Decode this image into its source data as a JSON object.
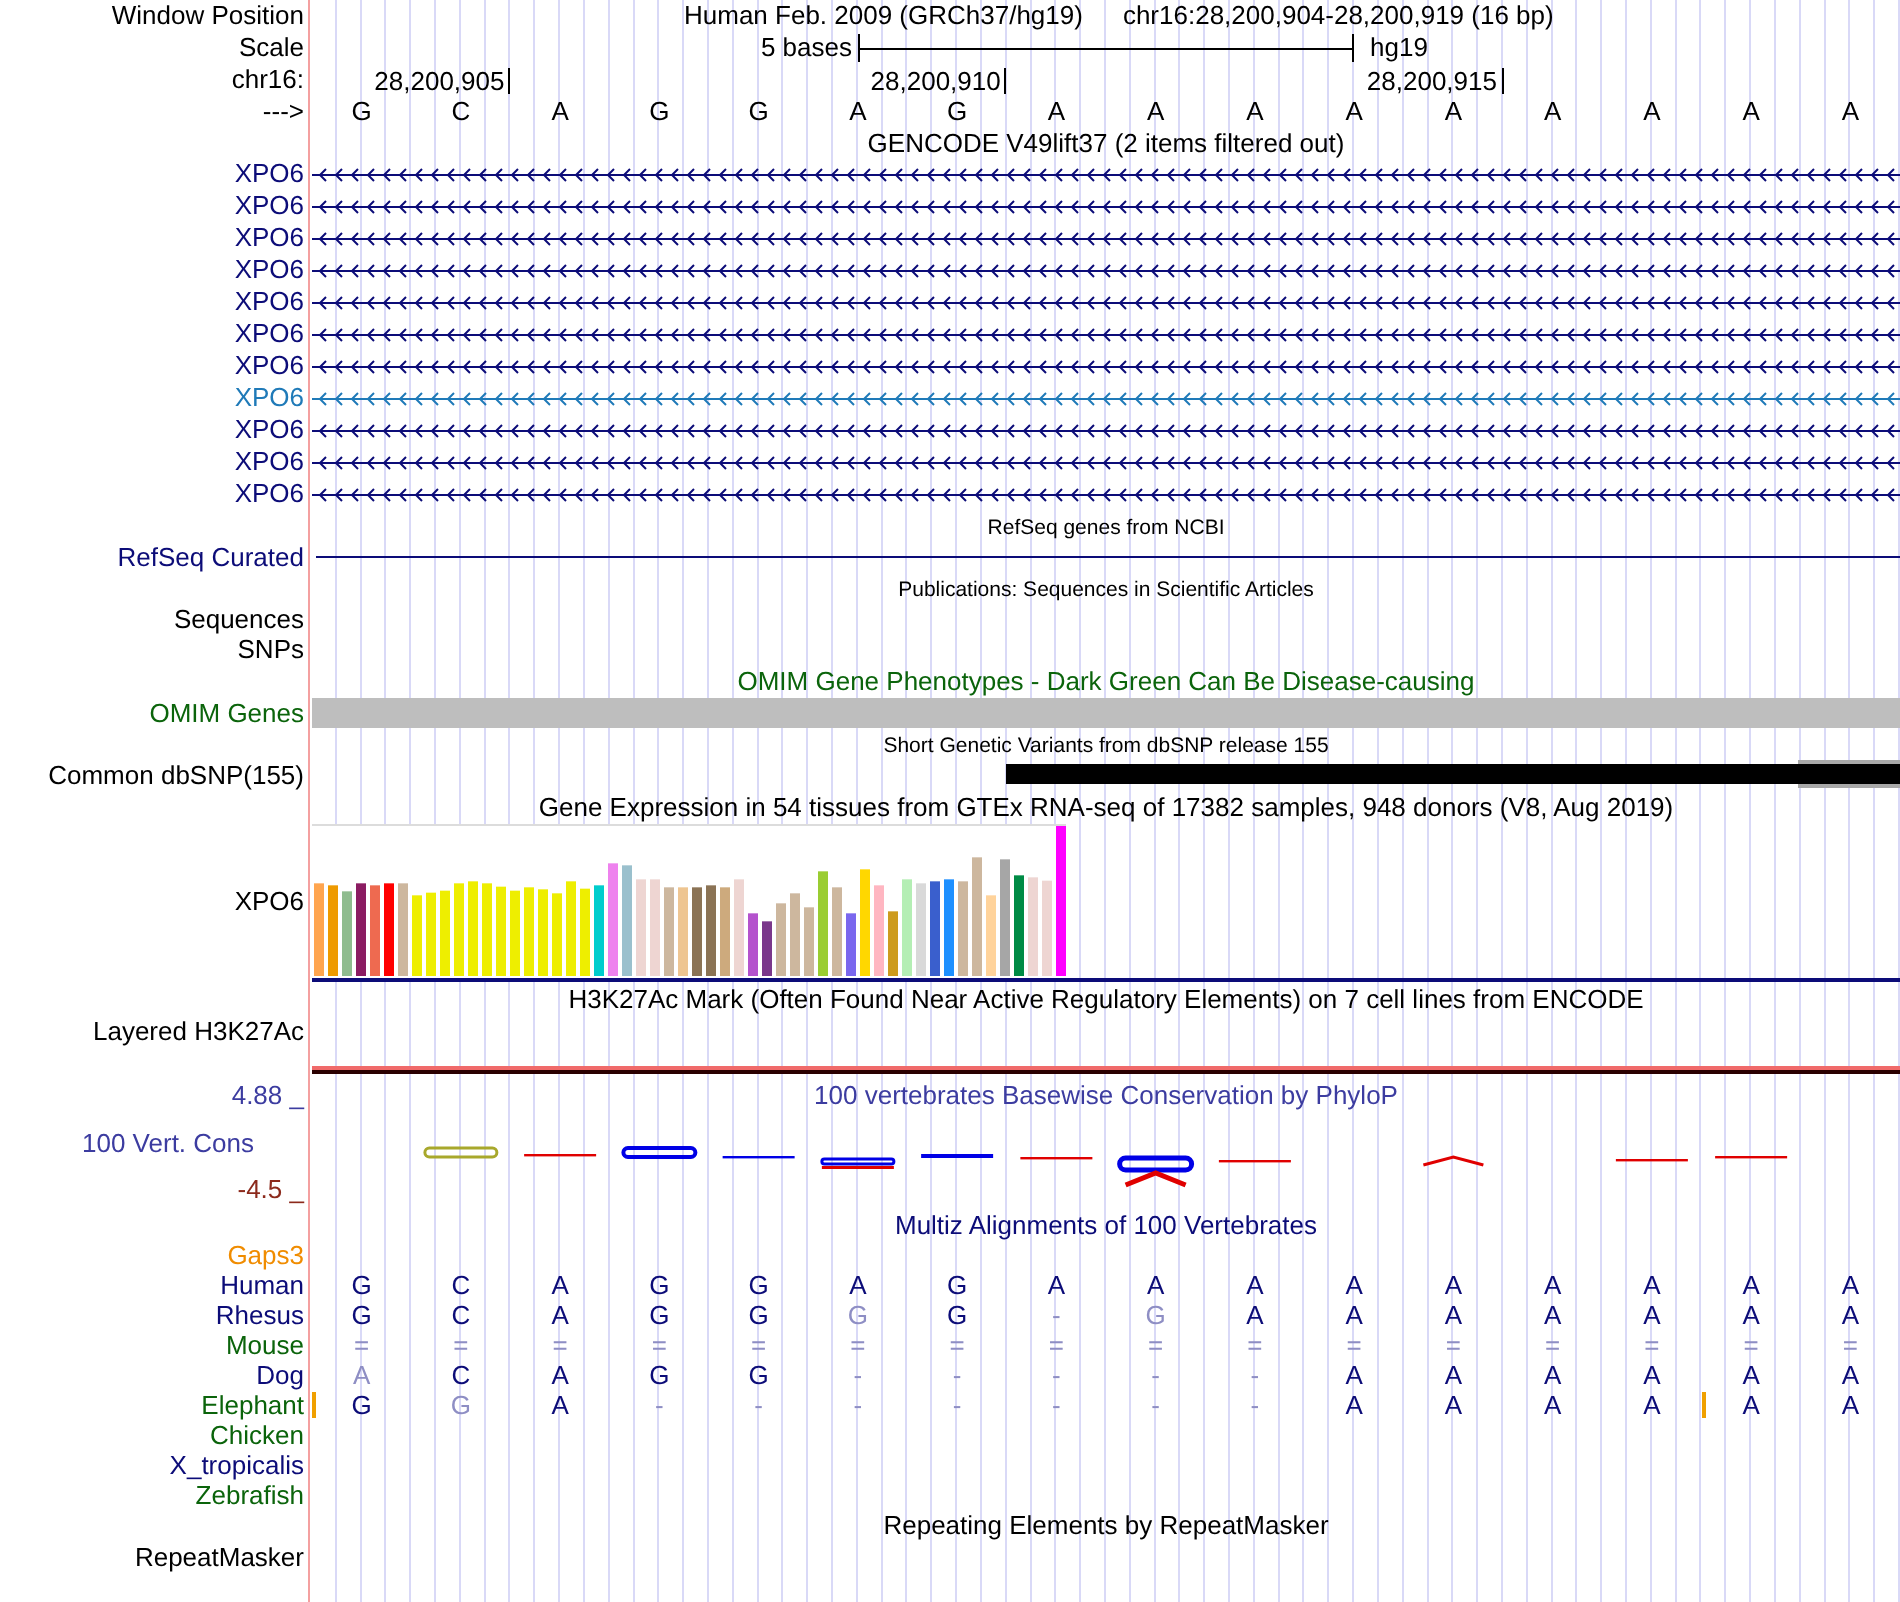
{
  "header": {
    "position": {
      "label": "Window Position",
      "assembly": "Human Feb. 2009 (GRCh37/hg19)",
      "range": "chr16:28,200,904-28,200,919 (16 bp)"
    },
    "scale": {
      "label": "Scale",
      "length": "5 bases",
      "assembly": "hg19"
    },
    "ruler": {
      "label": "chr16:",
      "ticks": [
        "28,200,905",
        "28,200,910",
        "28,200,915"
      ]
    },
    "sequence": {
      "label": "--->",
      "bases": [
        "G",
        "C",
        "A",
        "G",
        "G",
        "A",
        "G",
        "A",
        "A",
        "A",
        "A",
        "A",
        "A",
        "A",
        "A",
        "A"
      ]
    }
  },
  "tracks": [
    {
      "kind": "genes",
      "title": "GENCODE V49lift37 (2 items filtered out)",
      "items": [
        {
          "name": "XPO6",
          "color": "#0c0c78"
        },
        {
          "name": "XPO6",
          "color": "#0c0c78"
        },
        {
          "name": "XPO6",
          "color": "#0c0c78"
        },
        {
          "name": "XPO6",
          "color": "#0c0c78"
        },
        {
          "name": "XPO6",
          "color": "#0c0c78"
        },
        {
          "name": "XPO6",
          "color": "#0c0c78"
        },
        {
          "name": "XPO6",
          "color": "#0c0c78"
        },
        {
          "name": "XPO6",
          "color": "#1f7ab8"
        },
        {
          "name": "XPO6",
          "color": "#0c0c78"
        },
        {
          "name": "XPO6",
          "color": "#0c0c78"
        },
        {
          "name": "XPO6",
          "color": "#0c0c78"
        }
      ]
    },
    {
      "kind": "gene_line",
      "title": "RefSeq genes from NCBI",
      "label": "RefSeq Curated"
    },
    {
      "kind": "publications",
      "title": "Publications: Sequences in Scientific Articles",
      "labels": [
        "Sequences",
        "SNPs"
      ]
    },
    {
      "kind": "phenotypes",
      "title": "OMIM Gene Phenotypes - Dark Green Can Be Disease-causing",
      "label": "OMIM Genes"
    },
    {
      "kind": "variants",
      "title": "Short Genetic Variants from dbSNP release 155",
      "label": "Common dbSNP(155)"
    },
    {
      "kind": "expression",
      "title": "Gene Expression in 54 tissues from GTEx RNA-seq of 17382 samples, 948 donors (V8, Aug 2019)",
      "label": "XPO6"
    },
    {
      "kind": "signal",
      "title": "H3K27Ac Mark (Often Found Near Active Regulatory Elements) on 7 cell lines from ENCODE",
      "label": "Layered H3K27Ac"
    },
    {
      "kind": "conservation",
      "title": "100 vertebrates Basewise Conservation by PhyloP",
      "label": "100 Vert. Cons",
      "max_label": "4.88 _",
      "min_label": "-4.5 _"
    },
    {
      "kind": "alignment",
      "title": "Multiz Alignments of 100 Vertebrates",
      "gaps_label": "Gaps3",
      "species": [
        {
          "name": "Human",
          "color": "#0c0c78",
          "cells": [
            {
              "base": "G",
              "faded": false
            },
            {
              "base": "C",
              "faded": false
            },
            {
              "base": "A",
              "faded": false
            },
            {
              "base": "G",
              "faded": false
            },
            {
              "base": "G",
              "faded": false
            },
            {
              "base": "A",
              "faded": false
            },
            {
              "base": "G",
              "faded": false
            },
            {
              "base": "A",
              "faded": false
            },
            {
              "base": "A",
              "faded": false
            },
            {
              "base": "A",
              "faded": false
            },
            {
              "base": "A",
              "faded": false
            },
            {
              "base": "A",
              "faded": false
            },
            {
              "base": "A",
              "faded": false
            },
            {
              "base": "A",
              "faded": false
            },
            {
              "base": "A",
              "faded": false
            },
            {
              "base": "A",
              "faded": false
            }
          ]
        },
        {
          "name": "Rhesus",
          "color": "#0c0c78",
          "cells": [
            {
              "base": "G",
              "faded": false
            },
            {
              "base": "C",
              "faded": false
            },
            {
              "base": "A",
              "faded": false
            },
            {
              "base": "G",
              "faded": false
            },
            {
              "base": "G",
              "faded": false
            },
            {
              "base": "G",
              "faded": true
            },
            {
              "base": "G",
              "faded": false
            },
            {
              "base": "-",
              "faded": true
            },
            {
              "base": "G",
              "faded": true
            },
            {
              "base": "A",
              "faded": false
            },
            {
              "base": "A",
              "faded": false
            },
            {
              "base": "A",
              "faded": false
            },
            {
              "base": "A",
              "faded": false
            },
            {
              "base": "A",
              "faded": false
            },
            {
              "base": "A",
              "faded": false
            },
            {
              "base": "A",
              "faded": false
            }
          ]
        },
        {
          "name": "Mouse",
          "color": "#0b640b",
          "cells": [
            {
              "base": "=",
              "faded": true
            },
            {
              "base": "=",
              "faded": true
            },
            {
              "base": "=",
              "faded": true
            },
            {
              "base": "=",
              "faded": true
            },
            {
              "base": "=",
              "faded": true
            },
            {
              "base": "=",
              "faded": true
            },
            {
              "base": "=",
              "faded": true
            },
            {
              "base": "=",
              "faded": true
            },
            {
              "base": "=",
              "faded": true
            },
            {
              "base": "=",
              "faded": true
            },
            {
              "base": "=",
              "faded": true
            },
            {
              "base": "=",
              "faded": true
            },
            {
              "base": "=",
              "faded": true
            },
            {
              "base": "=",
              "faded": true
            },
            {
              "base": "=",
              "faded": true
            },
            {
              "base": "=",
              "faded": true
            }
          ]
        },
        {
          "name": "Dog",
          "color": "#0c0c78",
          "cells": [
            {
              "base": "A",
              "faded": true
            },
            {
              "base": "C",
              "faded": false
            },
            {
              "base": "A",
              "faded": false
            },
            {
              "base": "G",
              "faded": false
            },
            {
              "base": "G",
              "faded": false
            },
            {
              "base": "-",
              "faded": true
            },
            {
              "base": "-",
              "faded": true
            },
            {
              "base": "-",
              "faded": true
            },
            {
              "base": "-",
              "faded": true
            },
            {
              "base": "-",
              "faded": true
            },
            {
              "base": "A",
              "faded": false
            },
            {
              "base": "A",
              "faded": false
            },
            {
              "base": "A",
              "faded": false
            },
            {
              "base": "A",
              "faded": false
            },
            {
              "base": "A",
              "faded": false
            },
            {
              "base": "A",
              "faded": false
            }
          ]
        },
        {
          "name": "Elephant",
          "color": "#0b640b",
          "cells": [
            {
              "base": "G",
              "faded": false,
              "insert": true
            },
            {
              "base": "G",
              "faded": true,
              "insert": false
            },
            {
              "base": "A",
              "faded": false,
              "insert": false
            },
            {
              "base": "-",
              "faded": true,
              "insert": false
            },
            {
              "base": "-",
              "faded": true,
              "insert": false
            },
            {
              "base": "-",
              "faded": true,
              "insert": false
            },
            {
              "base": "-",
              "faded": true,
              "insert": false
            },
            {
              "base": "-",
              "faded": true,
              "insert": false
            },
            {
              "base": "-",
              "faded": true,
              "insert": false
            },
            {
              "base": "-",
              "faded": true,
              "insert": false
            },
            {
              "base": "A",
              "faded": false,
              "insert": false
            },
            {
              "base": "A",
              "faded": false,
              "insert": false
            },
            {
              "base": "A",
              "faded": false,
              "insert": false
            },
            {
              "base": "A",
              "faded": false,
              "insert": false
            },
            {
              "base": "A",
              "faded": false,
              "insert": true
            },
            {
              "base": "A",
              "faded": false,
              "insert": false
            }
          ]
        },
        {
          "name": "Chicken",
          "color": "#0b640b"
        },
        {
          "name": "X_tropicalis",
          "color": "#0c0c78"
        },
        {
          "name": "Zebrafish",
          "color": "#0b640b"
        }
      ]
    },
    {
      "kind": "repeats",
      "title": "Repeating Elements by RepeatMasker",
      "label": "RepeatMasker"
    }
  ]
}
